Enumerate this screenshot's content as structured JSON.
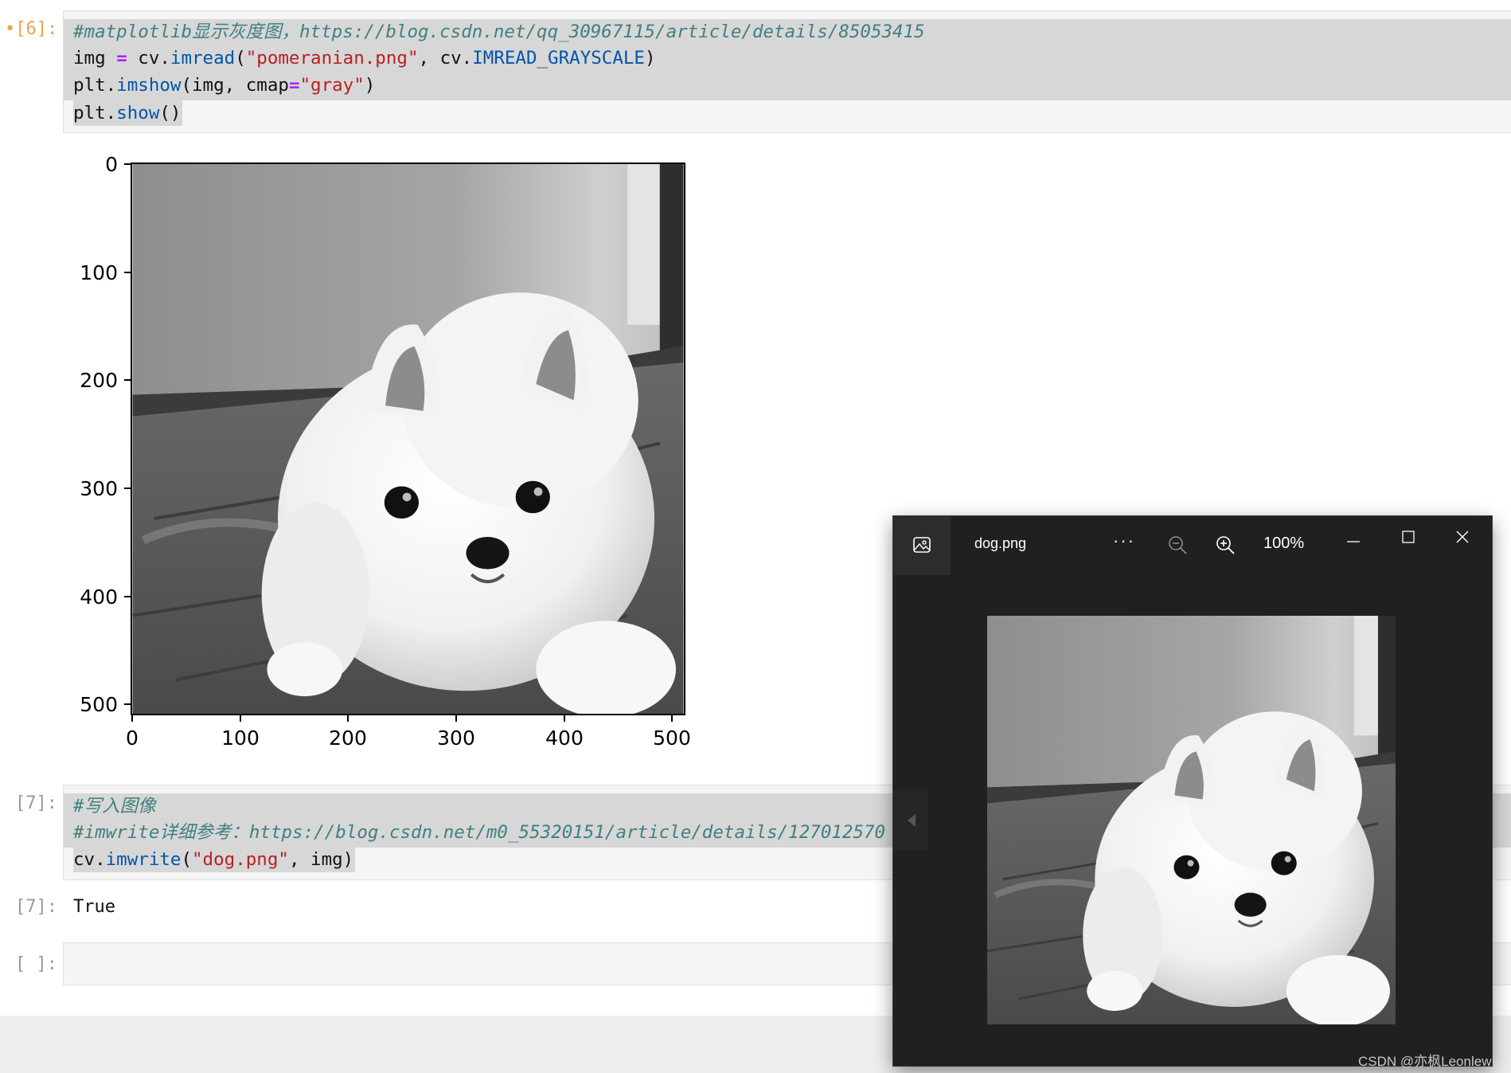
{
  "cells": {
    "c6": {
      "prompt": "•[6]:",
      "line1": "#matplotlib显示灰度图，https://blog.csdn.net/qq_30967115/article/details/85053415",
      "line2": {
        "a": "img ",
        "b": "=",
        "c": " cv.",
        "d": "imread",
        "e": "(",
        "f": "\"pomeranian.png\"",
        "g": ", cv.",
        "h": "IMREAD_GRAYSCALE",
        "i": ")"
      },
      "line3": {
        "a": "plt.",
        "b": "imshow",
        "c": "(img, cmap",
        "d": "=",
        "e": "\"gray\"",
        "f": ")"
      },
      "line4": {
        "a": "plt.",
        "b": "show",
        "c": "()"
      }
    },
    "c7": {
      "prompt": "[7]:",
      "line1": "#写入图像",
      "line2": "#imwrite详细参考：https://blog.csdn.net/m0_55320151/article/details/127012570",
      "line3": {
        "a": "cv.",
        "b": "imwrite",
        "c": "(",
        "d": "\"dog.png\"",
        "e": ", img)"
      },
      "out_prompt": "[7]:",
      "output": "True"
    },
    "c8": {
      "prompt": "[ ]:"
    }
  },
  "plot": {
    "y_ticks": [
      "0",
      "100",
      "200",
      "300",
      "400",
      "500"
    ],
    "x_ticks": [
      "0",
      "100",
      "200",
      "300",
      "400",
      "500"
    ]
  },
  "viewer": {
    "title": "dog.png",
    "zoom": "100%",
    "more": "···"
  },
  "watermark": "CSDN @亦枫Leonlew",
  "colors": {
    "viewer_bg": "#202020",
    "comment": "#408080",
    "string": "#ba2121",
    "function": "#0055aa",
    "operator": "#aa22ff"
  }
}
